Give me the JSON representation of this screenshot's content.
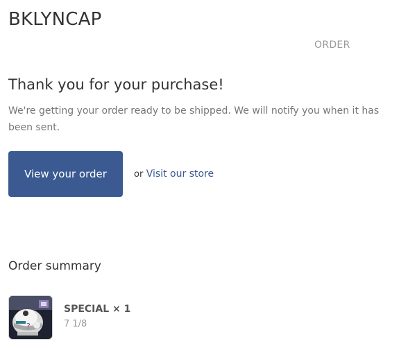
{
  "header": {
    "shop_name": "BKLYNCAP",
    "order_label": "ORDER"
  },
  "confirmation": {
    "heading": "Thank you for your purchase!",
    "message": "We're getting your order ready to be shipped. We will notify you when it has been sent."
  },
  "actions": {
    "view_order_label": "View your order",
    "or_text": "or",
    "visit_store_label": "Visit our store"
  },
  "summary": {
    "title": "Order summary",
    "items": [
      {
        "name": "SPECIAL × 1",
        "variant": "7 1/8",
        "image_icon": "product-thumbnail-icon"
      }
    ]
  },
  "colors": {
    "accent": "#3a5a91",
    "text": "#333333",
    "muted": "#777777",
    "light_muted": "#999999"
  }
}
